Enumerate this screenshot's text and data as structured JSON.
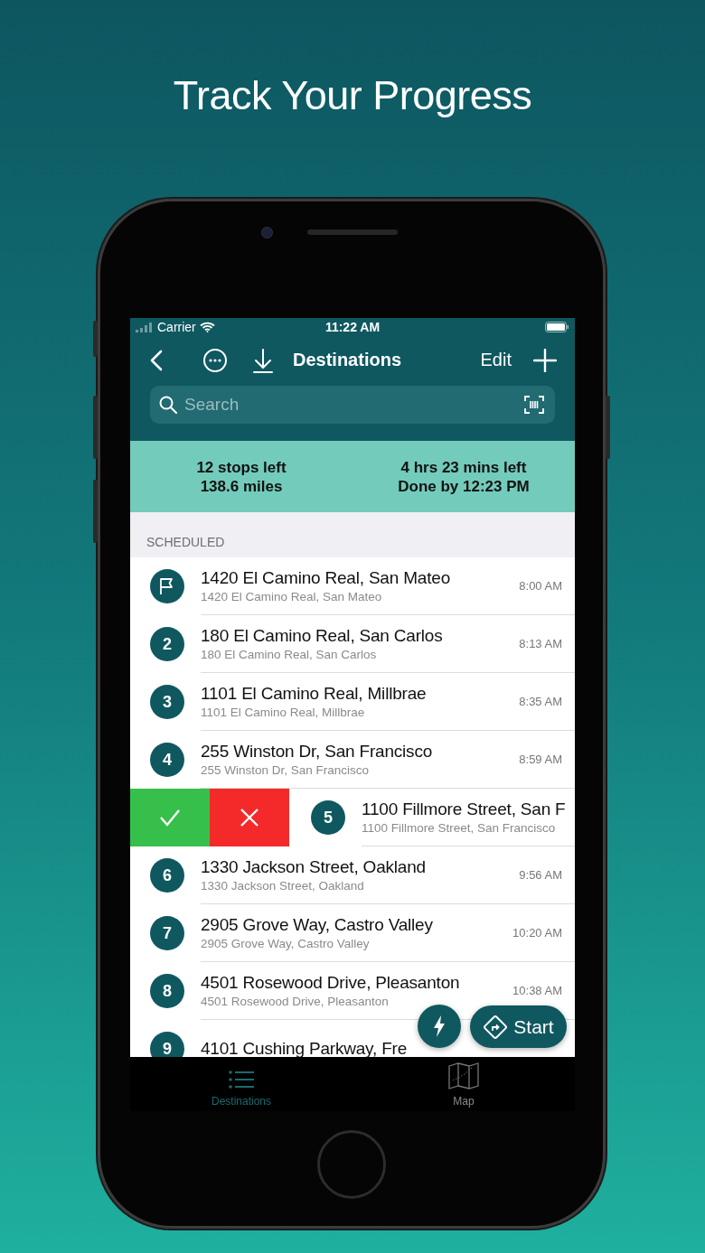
{
  "headline": "Track Your Progress",
  "status_bar": {
    "carrier": "Carrier",
    "time": "11:22 AM"
  },
  "nav": {
    "title": "Destinations",
    "edit": "Edit"
  },
  "search": {
    "placeholder": "Search"
  },
  "summary": [
    {
      "line1": "12 stops left",
      "line2": "138.6 miles"
    },
    {
      "line1": "4 hrs 23 mins left",
      "line2": "Done by 12:23 PM"
    }
  ],
  "section": "SCHEDULED",
  "rows": [
    {
      "kind": "start",
      "title": "1420 El Camino Real, San Mateo",
      "subtitle": "1420 El Camino Real, San Mateo",
      "time": "8:00 AM",
      "swiped": false
    },
    {
      "kind": "stop",
      "number": "2",
      "title": "180 El Camino Real, San Carlos",
      "subtitle": "180 El Camino Real, San Carlos",
      "time": "8:13 AM",
      "swiped": false
    },
    {
      "kind": "stop",
      "number": "3",
      "title": "1101 El Camino Real, Millbrae",
      "subtitle": "1101 El Camino Real, Millbrae",
      "time": "8:35 AM",
      "swiped": false
    },
    {
      "kind": "stop",
      "number": "4",
      "title": "255 Winston Dr, San Francisco",
      "subtitle": "255 Winston Dr, San Francisco",
      "time": "8:59 AM",
      "swiped": false
    },
    {
      "kind": "stop",
      "number": "5",
      "title": "1100 Fillmore Street, San F",
      "subtitle": "1100 Fillmore Street, San Francisco",
      "swiped": true
    },
    {
      "kind": "stop",
      "number": "6",
      "title": "1330 Jackson Street, Oakland",
      "subtitle": "1330 Jackson Street, Oakland",
      "time": "9:56 AM",
      "swiped": false
    },
    {
      "kind": "stop",
      "number": "7",
      "title": "2905 Grove Way, Castro Valley",
      "subtitle": "2905 Grove Way, Castro Valley",
      "time": "10:20 AM",
      "swiped": false
    },
    {
      "kind": "stop",
      "number": "8",
      "title": "4501 Rosewood Drive, Pleasanton",
      "subtitle": "4501 Rosewood Drive, Pleasanton",
      "time": "10:38 AM",
      "swiped": false
    },
    {
      "kind": "stop",
      "number": "9",
      "title": "4101 Cushing Parkway, Fre",
      "swiped": false
    }
  ],
  "start_button": "Start",
  "tabs": [
    {
      "label": "Destinations",
      "selected": true
    },
    {
      "label": "Map",
      "selected": false
    }
  ]
}
